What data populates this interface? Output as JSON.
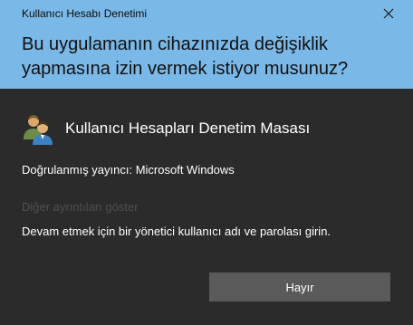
{
  "window": {
    "title": "Kullanıcı Hesabı Denetimi"
  },
  "header": {
    "question": "Bu uygulamanın cihazınızda değişiklik yapmasına izin vermek istiyor musunuz?"
  },
  "app": {
    "name": "Kullanıcı Hesapları Denetim Masası",
    "icon": "users-icon"
  },
  "publisher": {
    "text": "Doğrulanmış yayıncı: Microsoft Windows"
  },
  "details": {
    "link_text": "Diğer ayrıntıları göster"
  },
  "instructions": {
    "text": "Devam etmek için bir yönetici kullanıcı adı ve parolası girin."
  },
  "buttons": {
    "no_label": "Hayır"
  },
  "colors": {
    "header_bg": "#7ab8e8",
    "body_bg": "#2b2b2b",
    "button_bg": "#5a5a5a"
  }
}
